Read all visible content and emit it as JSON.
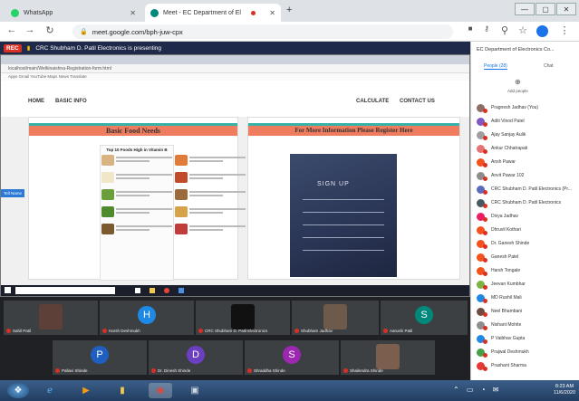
{
  "browser": {
    "tabs": [
      {
        "label": "WhatsApp",
        "favicon_color": "#25d366"
      },
      {
        "label": "Meet - EC Department of El",
        "favicon_color": "#00897b"
      }
    ],
    "new_tab": "+",
    "url": "meet.google.com/bph-juw-cpx",
    "window_controls": [
      "—",
      "▢",
      "✕"
    ]
  },
  "meet_bar": {
    "rec_label": "REC",
    "presenting_text": "CRC Shubham D. Patil Electronics is presenting"
  },
  "shared_screen": {
    "inner_url": "localhost/main/Welkinaishna-Registration-form.html",
    "bookmarks": "Apps  Gmail  YouTube  Maps  News  Translate",
    "nav": {
      "home": "HOME",
      "basic_info": "BASIC INFO",
      "calculate": "CALCULATE",
      "contact_us": "CONTACT US"
    },
    "left_heading": "Basic Food Needs",
    "food_card_title": "Top 10 Foods High in Vitamin B",
    "right_heading": "For More Information Please Register Here",
    "signup_label": "SIGN UP",
    "tag_button": "Tell Name"
  },
  "participants_panel": {
    "title": "EC Department of Electronics Co...",
    "tab_people": "People (28)",
    "tab_chat": "Chat",
    "add_label": "Add people",
    "people": [
      {
        "name": "Pragnesh Jadhav (You)",
        "color": "#8d6e63"
      },
      {
        "name": "Aditi Vinod Patel",
        "color": "#7e57c2"
      },
      {
        "name": "Ajay Sanjay Aulik",
        "color": "#9e9e9e"
      },
      {
        "name": "Ankur Chhatrapati",
        "color": "#e57373"
      },
      {
        "name": "Ansh Pawar",
        "color": "#f4511e"
      },
      {
        "name": "Anvit Pawar 102",
        "color": "#8d8d8d"
      },
      {
        "name": "CRC Shubham D. Patil Electronics (Pr...",
        "color": "#5c6bc0"
      },
      {
        "name": "CRC Shubham D. Patil Electronics",
        "color": "#455a64"
      },
      {
        "name": "Divya Jadhav",
        "color": "#e91e63"
      },
      {
        "name": "Dhruvil Kothari",
        "color": "#f4511e"
      },
      {
        "name": "Dr. Ganesh Shinde",
        "color": "#f4511e"
      },
      {
        "name": "Ganesh Patel",
        "color": "#f4511e"
      },
      {
        "name": "Harsh Tongale",
        "color": "#f4511e"
      },
      {
        "name": "Jeevan Kumbhar",
        "color": "#7cb342"
      },
      {
        "name": "MD Rushil Mali",
        "color": "#1e88e5"
      },
      {
        "name": "Neel Bhambani",
        "color": "#6d4c41"
      },
      {
        "name": "Nishant Mohite",
        "color": "#8e8e8e"
      },
      {
        "name": "P Vaibhav Gupta",
        "color": "#1e88e5"
      },
      {
        "name": "Prajwal Deshmukh",
        "color": "#43a047"
      },
      {
        "name": "Prashant Sharma",
        "color": "#e53935"
      }
    ]
  },
  "video_tiles": [
    {
      "name": "Sahil Patil",
      "initial": "",
      "color": "#5d4037"
    },
    {
      "name": "Harsh Deshmukh",
      "initial": "H",
      "color": "#1e88e5"
    },
    {
      "name": "CRC Shubham D. Patil Electronics",
      "initial": "",
      "color": "#111111"
    },
    {
      "name": "Shubham Jadhav",
      "initial": "",
      "color": "#6d5a4a"
    },
    {
      "name": "Aarushi Patil",
      "initial": "S",
      "color": "#00897b"
    },
    {
      "name": "Pallavi Shinde",
      "initial": "P",
      "color": "#1e5fbf"
    },
    {
      "name": "Dr. Dinesh Shinde",
      "initial": "D",
      "color": "#6a3fc0"
    },
    {
      "name": "Shraddha Shinde",
      "initial": "S",
      "color": "#9c27b0"
    },
    {
      "name": "Shailendra Shinde",
      "initial": "",
      "color": "#7b5e4e"
    }
  ],
  "taskbar": {
    "time": "8:23 AM",
    "date": "11/6/2020"
  }
}
